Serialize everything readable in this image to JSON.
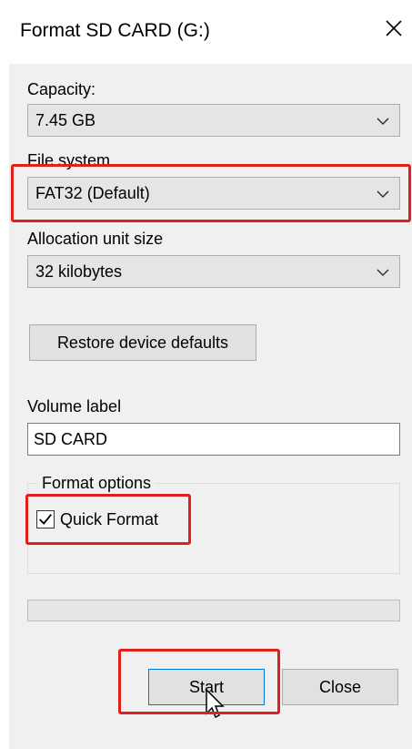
{
  "window": {
    "title": "Format SD CARD (G:)"
  },
  "capacity": {
    "label": "Capacity:",
    "value": "7.45 GB"
  },
  "file_system": {
    "label": "File system",
    "value": "FAT32 (Default)"
  },
  "allocation": {
    "label": "Allocation unit size",
    "value": "32 kilobytes"
  },
  "buttons": {
    "restore_defaults": "Restore device defaults",
    "start": "Start",
    "close": "Close"
  },
  "volume": {
    "label": "Volume label",
    "value": "SD CARD"
  },
  "format_options": {
    "title": "Format options",
    "quick_format_label": "Quick Format",
    "quick_format_checked": true
  },
  "progress": {
    "fraction": 0
  },
  "colors": {
    "highlight": "#e0201c",
    "dialog_bg": "#f0f0f0",
    "button_bg": "#e1e1e1"
  }
}
